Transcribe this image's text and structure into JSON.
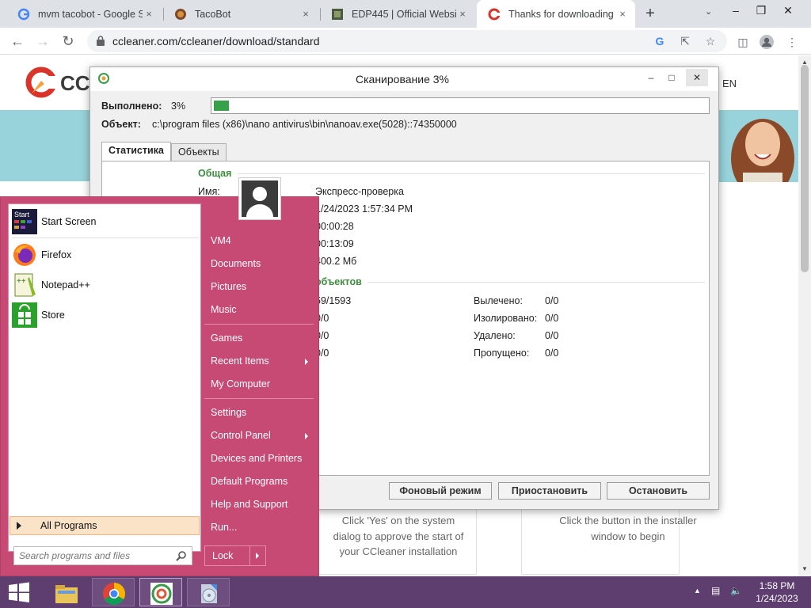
{
  "browser": {
    "tabs": [
      {
        "title": "mvm tacobot - Google Se",
        "close": "×",
        "active": false
      },
      {
        "title": "TacoBot",
        "close": "×",
        "active": false
      },
      {
        "title": "EDP445 | Official Website",
        "close": "×",
        "active": false
      },
      {
        "title": "Thanks for downloading",
        "close": "×",
        "active": true
      }
    ],
    "new_tab": "+",
    "url": "ccleaner.com/ccleaner/download/standard"
  },
  "page": {
    "logo_text": "CCle",
    "lang": "EN",
    "card1_text": "Click 'Yes' on the system dialog to approve the start of your CCleaner installation",
    "card2_text": "Click the button in the installer window to begin"
  },
  "dialog": {
    "title": "Сканирование 3%",
    "done_label": "Выполнено:",
    "done_value": "3%",
    "progress_percent": 3,
    "object_label": "Объект:",
    "object_value": "c:\\program files (x86)\\nano antivirus\\bin\\nanoav.exe(5028)::74350000",
    "tabs": [
      "Статистика",
      "Объекты"
    ],
    "section_general": "Общая",
    "name_label": "Имя:",
    "name_value": "Экспресс-проверка",
    "general_values": [
      "1/24/2023 1:57:34 PM",
      "00:00:28",
      "00:13:09",
      "400.2 Мб"
    ],
    "section_objects": "объектов",
    "objects_left": [
      "59/1593",
      "0/0",
      "0/0",
      "0/0"
    ],
    "objects_right": [
      {
        "label": "Вылечено:",
        "value": "0/0"
      },
      {
        "label": "Изолировано:",
        "value": "0/0"
      },
      {
        "label": "Удалено:",
        "value": "0/0"
      },
      {
        "label": "Пропущено:",
        "value": "0/0"
      }
    ],
    "buttons": {
      "background": "Фоновый режим",
      "pause": "Приостановить",
      "stop": "Остановить"
    }
  },
  "start_menu": {
    "pinned": [
      {
        "label": "Start Screen",
        "icon": "start-screen-icon"
      },
      {
        "label": "Firefox",
        "icon": "firefox-icon"
      },
      {
        "label": "Notepad++",
        "icon": "notepadpp-icon"
      },
      {
        "label": "Store",
        "icon": "store-icon"
      }
    ],
    "all_programs": "All Programs",
    "search_placeholder": "Search programs and files",
    "right_items": [
      {
        "label": "VM4",
        "arrow": false
      },
      {
        "label": "Documents",
        "arrow": false
      },
      {
        "label": "Pictures",
        "arrow": false
      },
      {
        "label": "Music",
        "arrow": false
      },
      {
        "label": "Games",
        "arrow": false
      },
      {
        "label": "Recent Items",
        "arrow": true
      },
      {
        "label": "My Computer",
        "arrow": false
      },
      {
        "label": "Settings",
        "arrow": false
      },
      {
        "label": "Control Panel",
        "arrow": true
      },
      {
        "label": "Devices and Printers",
        "arrow": false
      },
      {
        "label": "Default Programs",
        "arrow": false
      },
      {
        "label": "Help and Support",
        "arrow": false
      },
      {
        "label": "Run...",
        "arrow": false
      }
    ],
    "lock": "Lock"
  },
  "taskbar": {
    "time": "1:58 PM",
    "date": "1/24/2023"
  },
  "colors": {
    "start_menu": "#c64a73",
    "taskbar": "#5e3e6e",
    "progress": "#37a04a",
    "section": "#3f8c3f"
  }
}
